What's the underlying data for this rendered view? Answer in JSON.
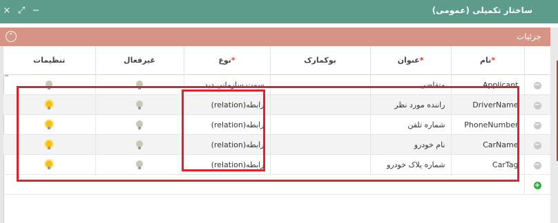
{
  "window": {
    "title": "ساختار تکمیلی (عمومی)",
    "close_glyph": "×",
    "expand_glyph": "⤢",
    "minimize_glyph": "−"
  },
  "section": {
    "title": "جزئیات",
    "collapse_glyph": "⌃"
  },
  "table": {
    "columns": {
      "name": "نام",
      "title": "عنوان",
      "bookmark": "بوکمارک",
      "type": "نوع",
      "inactive": "غیرفعال",
      "settings": "تنظیمات"
    },
    "rows": [
      {
        "name": "Applicant",
        "title": "متقاضی",
        "type": "سمت سازمانی دید...",
        "settings_active": false
      },
      {
        "name": "DriverName",
        "title": "راننده مورد نظر",
        "type": "رابطه(relation)",
        "settings_active": true
      },
      {
        "name": "PhoneNumber",
        "title": "شماره تلفن",
        "type": "رابطه(relation)",
        "settings_active": true
      },
      {
        "name": "CarName",
        "title": "نام خودرو",
        "type": "رابطه(relation)",
        "settings_active": true
      },
      {
        "name": "CarTag",
        "title": "شماره پلاک خودرو",
        "type": "رابطه(relation)",
        "settings_active": true
      }
    ]
  },
  "colors": {
    "titlebar": "#5d9c8a",
    "section_header": "#d59485",
    "highlight": "#e0202a",
    "add_button": "#2fae3f"
  }
}
